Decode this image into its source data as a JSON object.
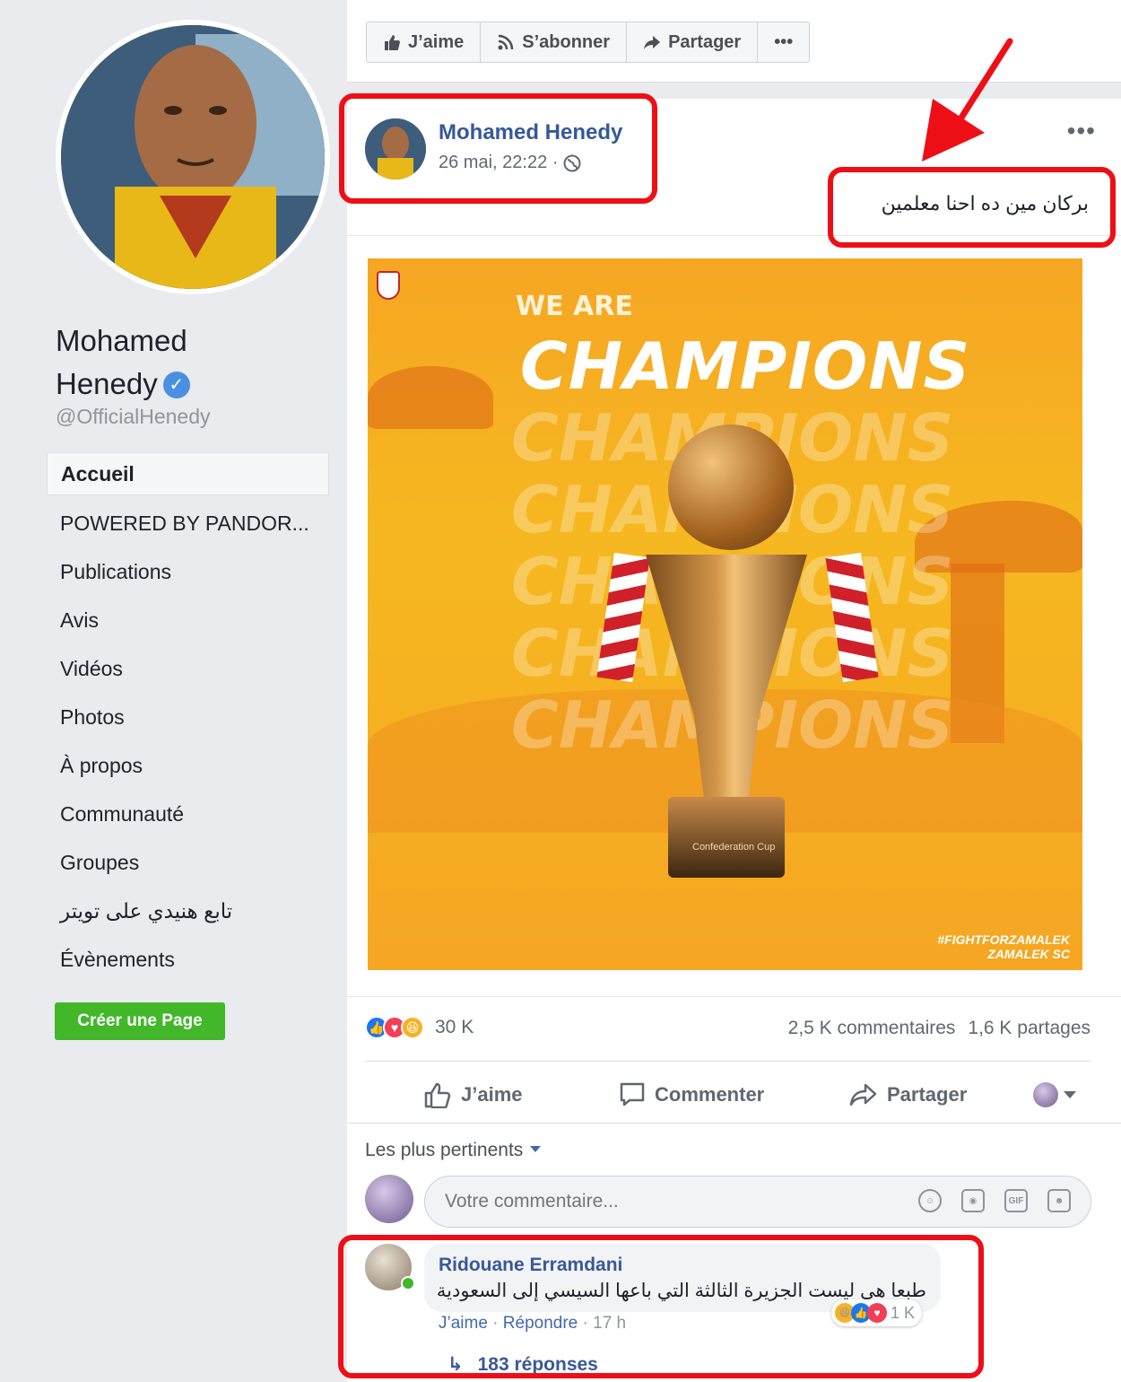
{
  "sidebar": {
    "page_name_line1": "Mohamed",
    "page_name_line2": "Henedy",
    "handle": "@OfficialHenedy",
    "nav": [
      {
        "label": "Accueil",
        "active": true
      },
      {
        "label": "POWERED BY PANDOR..."
      },
      {
        "label": "Publications"
      },
      {
        "label": "Avis"
      },
      {
        "label": "Vidéos"
      },
      {
        "label": "Photos"
      },
      {
        "label": "À propos"
      },
      {
        "label": "Communauté"
      },
      {
        "label": "Groupes"
      },
      {
        "label": "تابع هنيدي على تويتر"
      },
      {
        "label": "Évènements"
      }
    ],
    "create_page": "Créer une Page"
  },
  "top_actions": {
    "like": "J’aime",
    "subscribe": "S’abonner",
    "share": "Partager",
    "more": "•••"
  },
  "post": {
    "author": "Mohamed Henedy",
    "timestamp": "26 mai, 22:22 ·",
    "more": "•••",
    "text": "بركان مين ده احنا معلمين",
    "image": {
      "we_are": "WE ARE",
      "champions": "CHAMPIONS",
      "hashtag": "#FIGHTFORZAMALEK",
      "club": "ZAMALEK SC",
      "trophy_label": "Confederation Cup"
    },
    "reactions_count": "30 K",
    "comments_count": "2,5 K commentaires",
    "shares_count": "1,6 K partages",
    "actions": {
      "like": "J’aime",
      "comment": "Commenter",
      "share": "Partager"
    },
    "sort_label": "Les plus pertinents",
    "comment_placeholder": "Votre commentaire..."
  },
  "top_comment": {
    "author": "Ridouane Erramdani",
    "text": "طبعا هى ليست الجزيرة الثالثة التي باعها السيسي إلى السعودية",
    "like": "J’aime",
    "reply": "Répondre",
    "time": "17 h",
    "reactions": "1 K",
    "replies": "183 réponses"
  },
  "colors": {
    "link": "#365899",
    "annotation": "#ee0f16",
    "create_button": "#42b72a"
  }
}
